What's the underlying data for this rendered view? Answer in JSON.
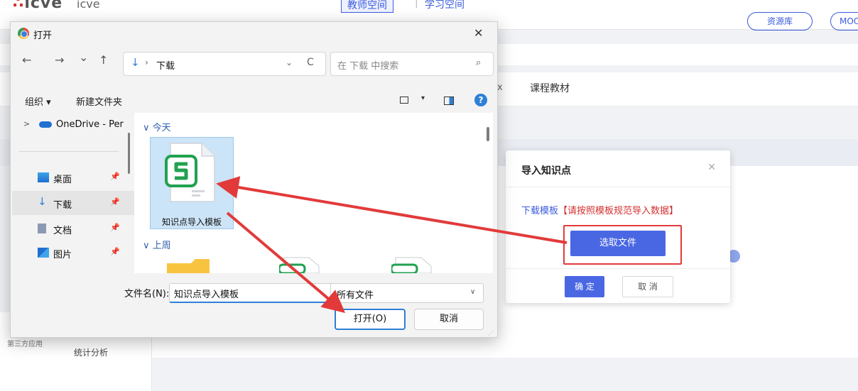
{
  "background": {
    "logo": "icve",
    "logo2": "icve",
    "nav_tab_active": "教师空间",
    "nav_tab_sep": "|",
    "nav_tab_2": "学习空间",
    "resource_btn": "资源库",
    "mooc_btn": "MOOC",
    "course_material_tab": "课程教材",
    "partial_tab": "x",
    "side_label_a": "第三方应用",
    "side_label_b": "统计分析"
  },
  "import_modal": {
    "title": "导入知识点",
    "close": "✕",
    "download_link": "下载模板",
    "download_hint": "【请按照模板规范导入数据】",
    "pick_file": "选取文件",
    "ok": "确 定",
    "cancel": "取 消"
  },
  "file_dialog": {
    "title": "打开",
    "close": "✕",
    "nav": {
      "back": "←",
      "forward": "→",
      "recent": "⌄",
      "up": "↑"
    },
    "address": {
      "path": "下载",
      "dropdown": "⌄",
      "refresh": "C"
    },
    "search_placeholder": "在 下载 中搜索",
    "search_icon": "⌕",
    "toolbar": {
      "organize": "组织 ▾",
      "new_folder": "新建文件夹",
      "view_dropdown": "▾",
      "help": "?"
    },
    "sidebar": [
      {
        "label": "OneDrive - Per",
        "icon": "cloud-icon"
      },
      {
        "label": "桌面",
        "icon": "desktop-icon"
      },
      {
        "label": "下载",
        "icon": "download-icon",
        "selected": true
      },
      {
        "label": "文档",
        "icon": "document-icon"
      },
      {
        "label": "图片",
        "icon": "picture-icon"
      }
    ],
    "pin": "📌",
    "groups": {
      "today": "∨ 今天",
      "last_week": "∨ 上周"
    },
    "file_tile": "知识点导入模板",
    "filename_label": "文件名(N):",
    "filename_value": "知识点导入模板",
    "filetype_value": "所有文件",
    "open_btn": "打开(O)",
    "cancel_btn": "取消"
  },
  "colors": {
    "accent": "#4a67e3",
    "annotation_red": "#e23a3a",
    "win_blue": "#2f7fd6",
    "wps_green": "#21a150"
  }
}
